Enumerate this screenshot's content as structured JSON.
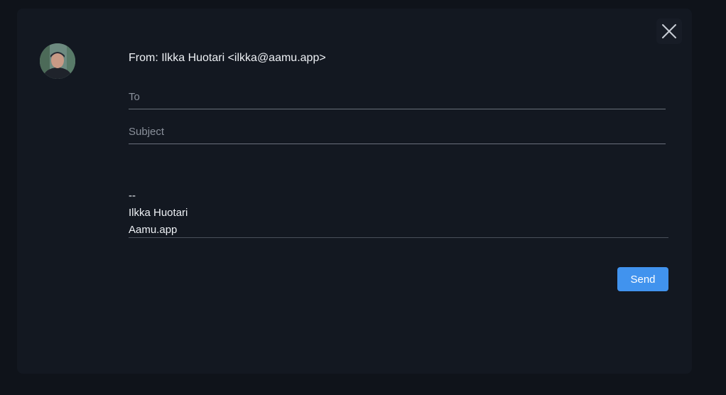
{
  "compose": {
    "from_line": "From: Ilkka Huotari <ilkka@aamu.app>",
    "to": {
      "value": "",
      "placeholder": "To"
    },
    "subject": {
      "value": "",
      "placeholder": "Subject"
    },
    "body": {
      "signature_separator": "--",
      "signature_name": "Ilkka Huotari",
      "signature_company": "Aamu.app"
    },
    "send_label": "Send"
  },
  "icons": {
    "close": "close-icon",
    "avatar": "user-avatar"
  },
  "colors": {
    "page_background": "#0f131a",
    "panel_background": "#131821",
    "accent": "#4193ee",
    "text": "#eef1f5",
    "placeholder": "#8a909b"
  }
}
